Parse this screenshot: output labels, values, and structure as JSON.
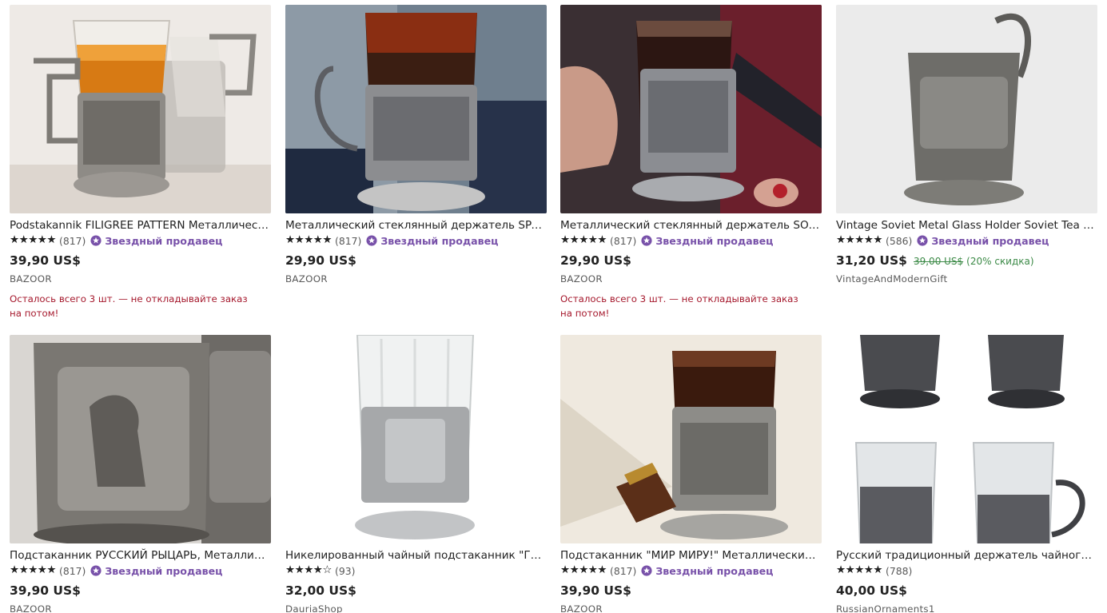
{
  "listings": [
    {
      "title": "Podstakannik FILIGREE PATTERN Металлический держатель для чайного стакана",
      "stars": "★★★★★",
      "count": "(817)",
      "badge": "Звездный продавец",
      "price": "39,90 US$",
      "shop": "BAZOOR",
      "alert": "Осталось всего 3 шт. — не откладывайте заказ на потом!"
    },
    {
      "title": "Металлический стеклянный держатель SPACE Подстаканник",
      "stars": "★★★★★",
      "count": "(817)",
      "badge": "Звездный продавец",
      "price": "29,90 US$",
      "shop": "BAZOOR"
    },
    {
      "title": "Металлический стеклянный держатель SOVIET Подстаканник",
      "stars": "★★★★★",
      "count": "(817)",
      "badge": "Звездный продавец",
      "price": "29,90 US$",
      "shop": "BAZOOR",
      "alert": "Осталось всего 3 шт. — не откладывайте заказ на потом!"
    },
    {
      "title": "Vintage Soviet Metal Glass Holder Soviet Tea Cup Holder",
      "stars": "★★★★★",
      "count": "(586)",
      "badge": "Звездный продавец",
      "price": "31,20 US$",
      "old_price": "39,00 US$",
      "discount": "(20% скидка)",
      "shop": "VintageAndModernGift"
    },
    {
      "title": "Подстаканник РУССКИЙ РЫЦАРЬ, Металлический держатель",
      "stars": "★★★★★",
      "count": "(817)",
      "badge": "Звездный продавец",
      "price": "39,90 US$",
      "shop": "BAZOOR"
    },
    {
      "title": "Никелированный чайный подстаканник \"Герб России\"",
      "stars": "★★★★☆",
      "count": "(93)",
      "price": "32,00 US$",
      "shop": "DauriaShop"
    },
    {
      "title": "Подстаканник \"МИР МИРУ!\" Металлический стеклянный держатель",
      "stars": "★★★★★",
      "count": "(817)",
      "badge": "Звездный продавец",
      "price": "39,90 US$",
      "shop": "BAZOOR"
    },
    {
      "title": "Русский традиционный держатель чайного стакана",
      "stars": "★★★★★",
      "count": "(788)",
      "price": "40,00 US$",
      "shop": "RussianOrnaments1"
    }
  ],
  "colors": {
    "badge": "#7851a9",
    "alert": "#a61a2e",
    "discount": "#3c8a47"
  }
}
